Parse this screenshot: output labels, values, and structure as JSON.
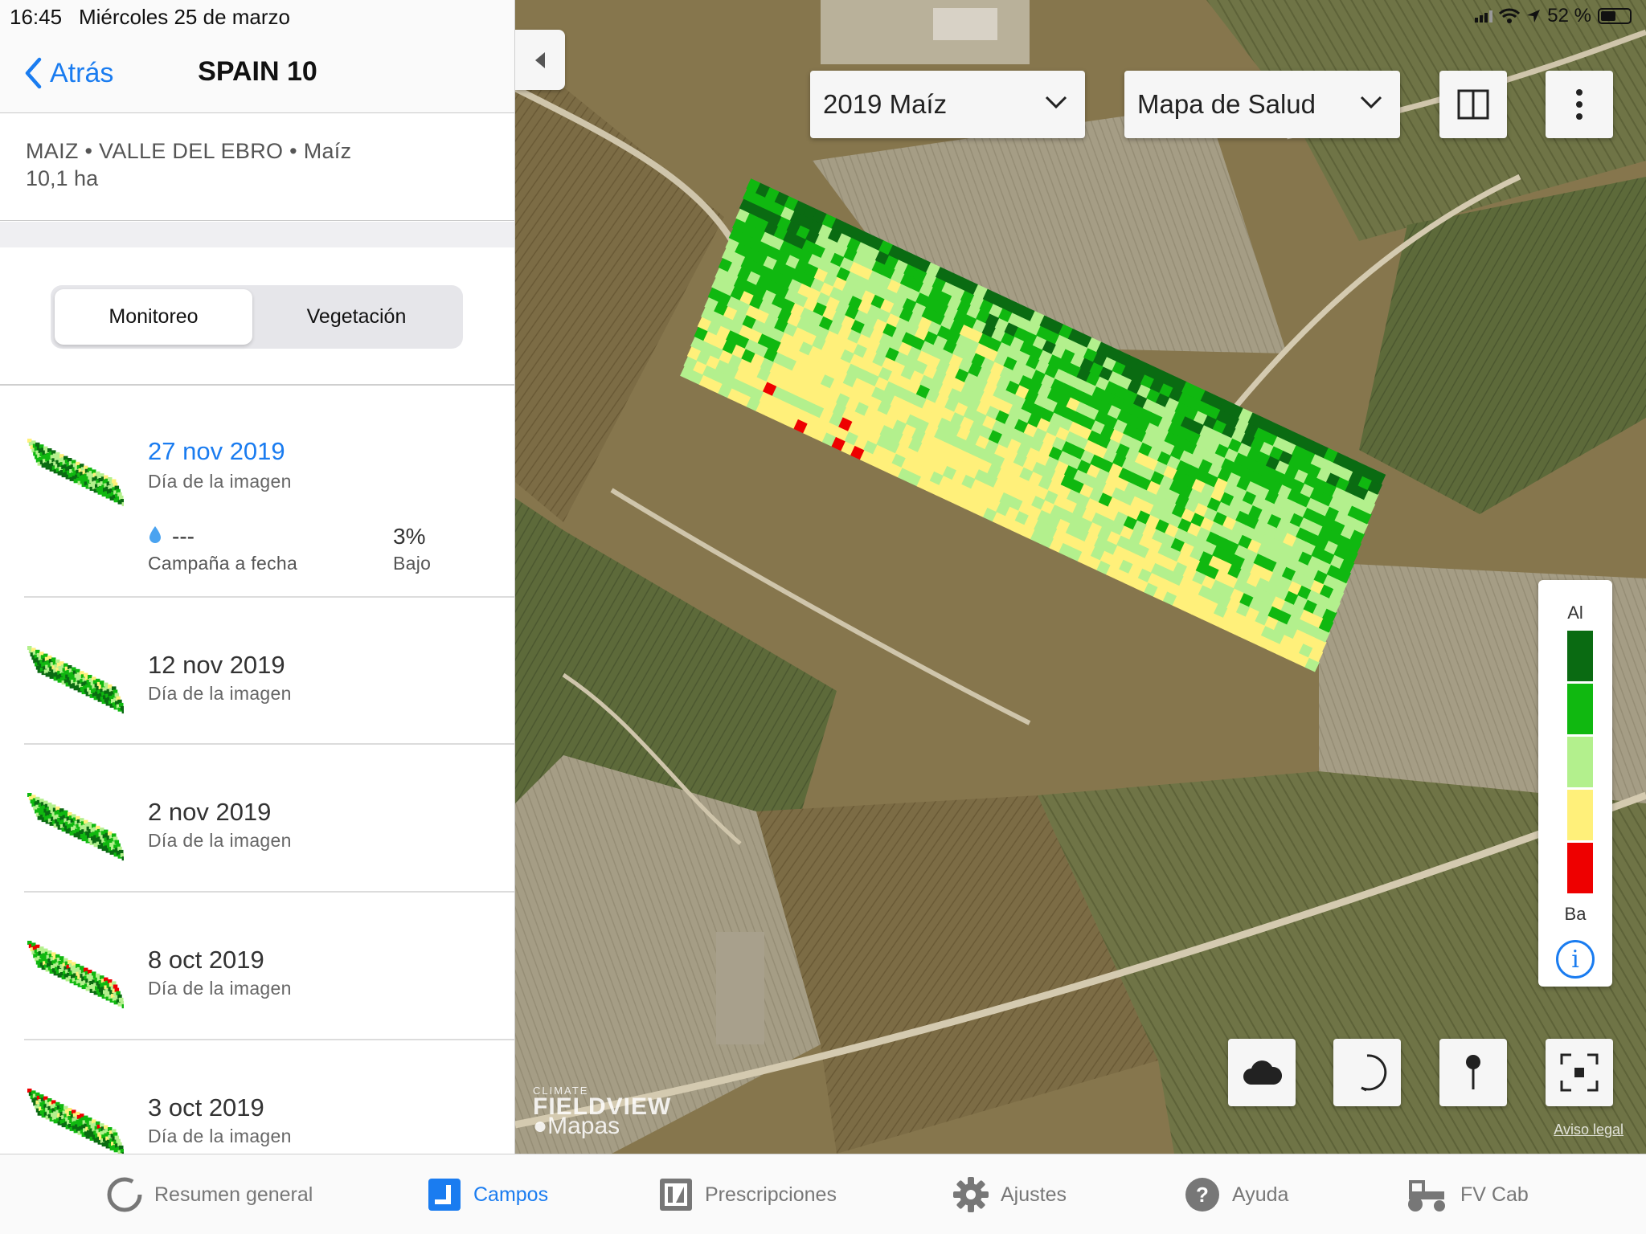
{
  "status": {
    "time": "16:45",
    "date": "Miércoles 25 de marzo",
    "battery": "52 %",
    "battery_level": 0.52
  },
  "nav": {
    "back_label": "Atrás",
    "title": "SPAIN 10"
  },
  "field": {
    "line1": "MAIZ • VALLE DEL EBRO • Maíz",
    "area": "10,1 ha"
  },
  "segment": {
    "options": [
      "Monitoreo",
      "Vegetación"
    ],
    "selected": "Monitoreo"
  },
  "images": [
    {
      "date": "27 nov 2019",
      "sub": "Día de la imagen",
      "rain_value": "---",
      "rain_label": "Campaña a fecha",
      "stress_value": "3%",
      "stress_label": "Bajo",
      "selected": true
    },
    {
      "date": "12 nov 2019",
      "sub": "Día de la imagen"
    },
    {
      "date": "2 nov 2019",
      "sub": "Día de la imagen"
    },
    {
      "date": "8 oct 2019",
      "sub": "Día de la imagen"
    },
    {
      "date": "3 oct 2019",
      "sub": "Día de la imagen"
    }
  ],
  "map": {
    "season_dropdown": "2019 Maíz",
    "layer_dropdown": "Mapa de Salud",
    "legend_high": "Al",
    "legend_low": "Ba",
    "legend_colors": [
      "#0a6b12",
      "#10b810",
      "#b3f08d",
      "#fff07a",
      "#ee0000"
    ],
    "watermark_climate": "CLIMATE",
    "watermark_fieldview": "FIELDVIEW",
    "watermark_maps": "Mapas",
    "legal": "Aviso legal"
  },
  "tabs": [
    {
      "label": "Resumen general",
      "icon": "ring-icon",
      "active": false
    },
    {
      "label": "Campos",
      "icon": "field-icon",
      "active": true
    },
    {
      "label": "Prescripciones",
      "icon": "prescription-icon",
      "active": false
    },
    {
      "label": "Ajustes",
      "icon": "gear-icon",
      "active": false
    },
    {
      "label": "Ayuda",
      "icon": "help-icon",
      "active": false
    },
    {
      "label": "FV Cab",
      "icon": "tractor-icon",
      "active": false
    }
  ],
  "colors": {
    "accent": "#1a7cf0"
  }
}
